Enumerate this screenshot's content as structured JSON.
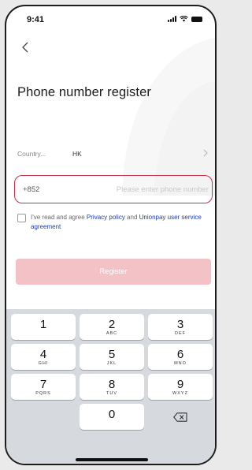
{
  "status_bar": {
    "time": "9:41"
  },
  "header": {
    "title": "Phone number register"
  },
  "country": {
    "label": "Country...",
    "value": "HK"
  },
  "phone": {
    "prefix": "+852",
    "placeholder": "Please enter phone number",
    "value": ""
  },
  "agreement": {
    "prefix": "I've read and agree ",
    "privacy_link": "Privacy policy",
    "and": " and ",
    "unionpay_link": "Unionpay user service agreement",
    "checked": false
  },
  "register_button": {
    "label": "Register",
    "color": "#f2c2c6"
  },
  "colors": {
    "input_border": "#c8334a",
    "link": "#1e3ea8",
    "keypad_bg": "#d6d9de"
  },
  "keypad": {
    "keys": [
      {
        "digit": "1",
        "letters": ""
      },
      {
        "digit": "2",
        "letters": "ABC"
      },
      {
        "digit": "3",
        "letters": "DEF"
      },
      {
        "digit": "4",
        "letters": "GHI"
      },
      {
        "digit": "5",
        "letters": "JKL"
      },
      {
        "digit": "6",
        "letters": "MNO"
      },
      {
        "digit": "7",
        "letters": "PQRS"
      },
      {
        "digit": "8",
        "letters": "TUV"
      },
      {
        "digit": "9",
        "letters": "WXYZ"
      },
      {
        "digit": "0",
        "letters": ""
      }
    ],
    "delete_icon": "backspace-icon"
  }
}
